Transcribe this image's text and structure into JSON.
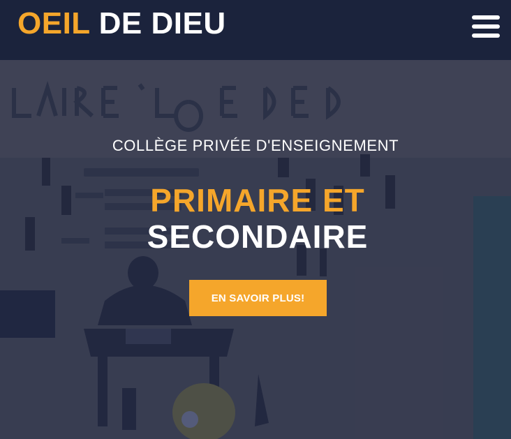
{
  "header": {
    "brand_accent": "OEIL",
    "brand_rest": "DE DIEU",
    "menu_icon": "hamburger-menu-icon"
  },
  "hero": {
    "subtitle": "COLLÈGE PRIVÉE D'ENSEIGNEMENT",
    "headline_line1": "PRIMAIRE ET",
    "headline_line2": "SECONDAIRE",
    "cta_label": "EN SAVOIR PLUS!"
  },
  "colors": {
    "accent": "#f5a62b",
    "header_bg": "#1b233c",
    "text_light": "#ffffff"
  }
}
